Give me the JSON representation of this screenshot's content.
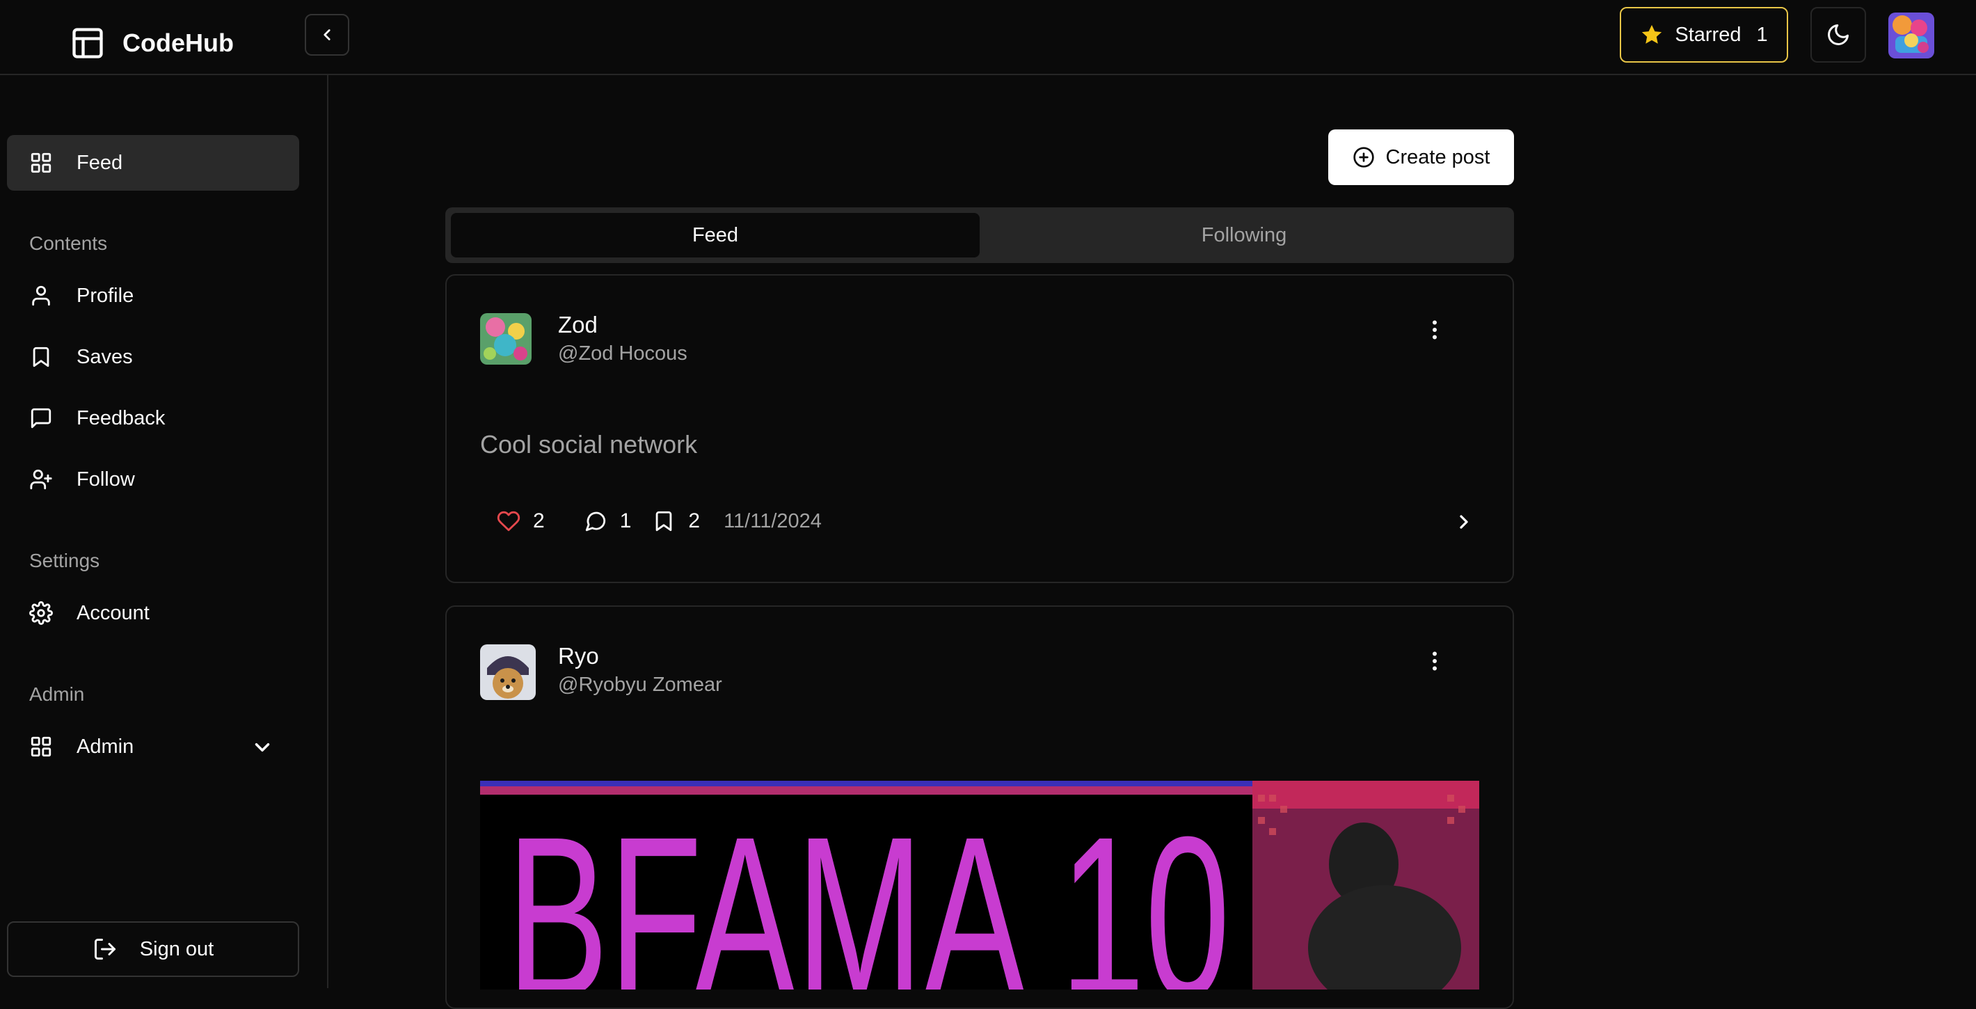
{
  "app": {
    "name": "CodeHub"
  },
  "header": {
    "starred_label": "Starred",
    "starred_count": "1"
  },
  "sidebar": {
    "top_item": {
      "label": "Feed",
      "icon": "grid-icon"
    },
    "sections": [
      {
        "title": "Contents",
        "items": [
          {
            "label": "Profile",
            "icon": "user-icon"
          },
          {
            "label": "Saves",
            "icon": "bookmark-icon"
          },
          {
            "label": "Feedback",
            "icon": "message-icon"
          },
          {
            "label": "Follow",
            "icon": "user-plus-icon"
          }
        ]
      },
      {
        "title": "Settings",
        "items": [
          {
            "label": "Account",
            "icon": "gear-icon"
          }
        ]
      },
      {
        "title": "Admin",
        "items": [
          {
            "label": "Admin",
            "icon": "grid-icon"
          }
        ]
      }
    ],
    "signout_label": "Sign out"
  },
  "main": {
    "create_post_label": "Create post",
    "tabs": [
      {
        "label": "Feed",
        "active": true
      },
      {
        "label": "Following",
        "active": false
      }
    ],
    "posts": [
      {
        "name": "Zod",
        "handle": "@Zod Hocous",
        "text": "Cool social network",
        "likes": "2",
        "comments": "1",
        "saves": "2",
        "date": "11/11/2024"
      },
      {
        "name": "Ryo",
        "handle": "@Ryobyu Zomear",
        "image_text": "BFAMA 10"
      }
    ]
  },
  "colors": {
    "background": "#0a0a0a",
    "border": "#262626",
    "star_accent": "#e8c547",
    "like_red": "#e5484d",
    "image_magenta": "#c83cd0"
  }
}
